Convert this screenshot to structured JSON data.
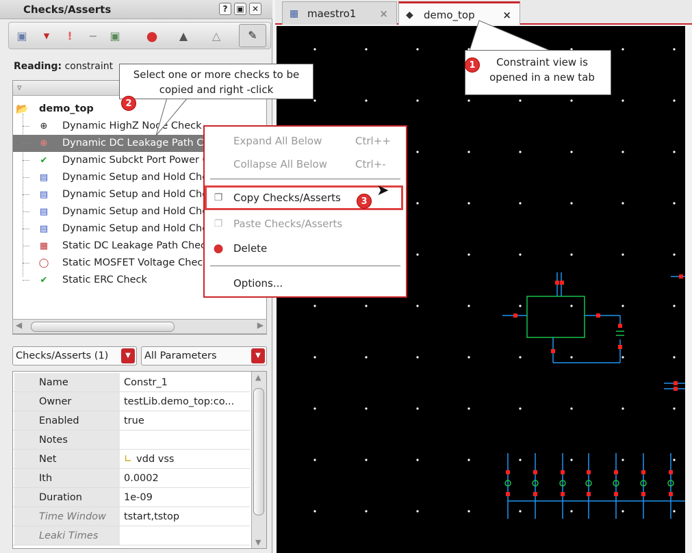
{
  "panel": {
    "title": "Checks/Asserts",
    "win_buttons": [
      "?",
      "▣",
      "✕"
    ],
    "reading_label": "Reading:",
    "reading_value": "constraint"
  },
  "tree": {
    "root": "demo_top",
    "items": [
      {
        "label": "Dynamic HighZ Node Check",
        "icon": "highz-check-icon"
      },
      {
        "label": "Dynamic DC Leakage Path Check",
        "icon": "leakage-check-icon",
        "selected": true
      },
      {
        "label": "Dynamic Subckt Port Power Check",
        "icon": "green-check-icon"
      },
      {
        "label": "Dynamic Setup and Hold Check",
        "icon": "setup-hold-icon"
      },
      {
        "label": "Dynamic Setup and Hold Check",
        "icon": "setup-hold-icon"
      },
      {
        "label": "Dynamic Setup and Hold Check",
        "icon": "setup-hold-icon"
      },
      {
        "label": "Dynamic Setup and Hold Check",
        "icon": "setup-hold-icon"
      },
      {
        "label": "Static DC Leakage Path Check",
        "icon": "static-leakage-icon"
      },
      {
        "label": "Static MOSFET Voltage Check",
        "icon": "mosfet-voltage-icon"
      },
      {
        "label": "Static ERC Check",
        "icon": "green-check-icon"
      }
    ]
  },
  "filters": {
    "checks_combo": "Checks/Asserts (1)",
    "params_combo": "All Parameters"
  },
  "properties": [
    {
      "key": "Name",
      "value": "Constr_1"
    },
    {
      "key": "Owner",
      "value": "testLib.demo_top:co..."
    },
    {
      "key": "Enabled",
      "value": "true"
    },
    {
      "key": "Notes",
      "value": ""
    },
    {
      "key": "Net",
      "value": "vdd vss"
    },
    {
      "key": "Ith",
      "value": "0.0002"
    },
    {
      "key": "Duration",
      "value": "1e-09"
    },
    {
      "key": "Time Window",
      "value": "tstart,tstop",
      "dim": true
    },
    {
      "key": "Leaki Times",
      "value": "",
      "dim": true
    }
  ],
  "tabs": [
    {
      "label": "maestro1",
      "close": "×"
    },
    {
      "label": "demo_top",
      "close": "×"
    }
  ],
  "menu": {
    "expand": {
      "label": "Expand All Below",
      "shortcut": "Ctrl++"
    },
    "collapse": {
      "label": "Collapse All Below",
      "shortcut": "Ctrl+-"
    },
    "copy": {
      "label": "Copy Checks/Asserts"
    },
    "paste": {
      "label": "Paste Checks/Asserts"
    },
    "delete": {
      "label": "Delete"
    },
    "options": {
      "label": "Options..."
    }
  },
  "callouts": {
    "one": {
      "badge": "1",
      "text": "Constraint view is opened in a new tab"
    },
    "two": {
      "badge": "2",
      "text": "Select one or more checks to be copied and right -click"
    },
    "three": {
      "badge": "3"
    }
  },
  "colors": {
    "accent": "#c8262b",
    "canvas_bg": "#000000",
    "wire_blue": "#2196f3",
    "wire_green": "#19c24a",
    "pin_red": "#ff2020"
  }
}
